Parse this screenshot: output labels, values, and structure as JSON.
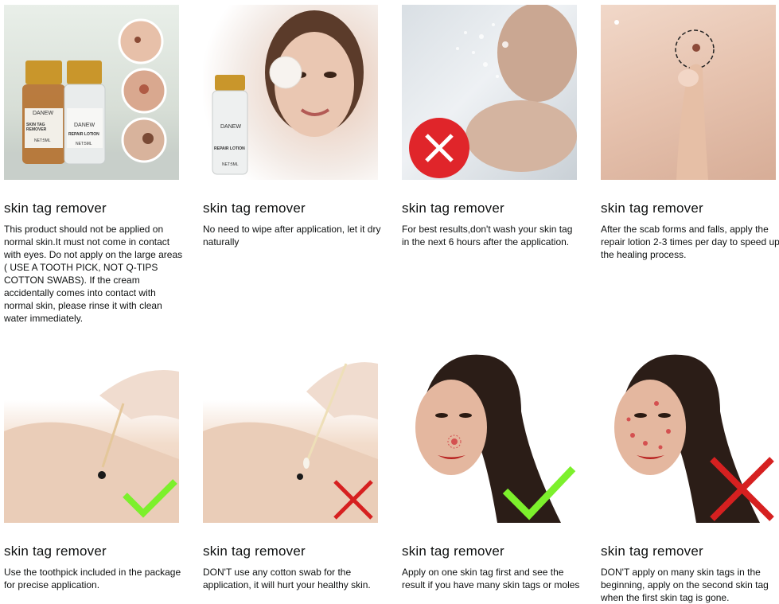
{
  "cards": [
    {
      "title": "skin tag remover",
      "desc": "This product should not be applied on normal skin.It must not come in contact with eyes. Do not apply on the large areas ( USE A TOOTH PICK, NOT Q-TIPS COTTON SWABS). If the cream accidentally comes into contact with normal skin, please rinse it with clean water immediately.",
      "bottle1_brand": "DANEW",
      "bottle1_label": "SKIN TAG REMOVER",
      "bottle1_size": "NET:5ML",
      "bottle2_brand": "DANEW",
      "bottle2_label": "REPAIR LOTION",
      "bottle2_size": "NET:5ML"
    },
    {
      "title": "skin tag remover",
      "desc": "No need to wipe after application, let it dry naturally",
      "bottle_brand": "DANEW",
      "bottle_label": "REPAIR LOTION",
      "bottle_size": "NET:5ML"
    },
    {
      "title": "skin tag remover",
      "desc": "For best results,don't wash your skin tag in the next 6 hours after the application."
    },
    {
      "title": "skin tag remover",
      "desc": "After the scab forms and falls, apply the repair lotion 2-3 times per day to speed up the healing process."
    },
    {
      "title": "skin tag remover",
      "desc": "Use the toothpick included in the package for precise application."
    },
    {
      "title": "skin tag remover",
      "desc": "DON'T use any cotton swab for the application, it will hurt your healthy skin."
    },
    {
      "title": "skin tag remover",
      "desc": "Apply on one skin tag first and see the result if you have many skin tags or moles"
    },
    {
      "title": "skin tag remover",
      "desc": "DON'T apply on many skin tags in the beginning, apply on the second skin tag when the first skin tag is gone."
    }
  ],
  "colors": {
    "check_green": "#7cf02c",
    "cross_red": "#d62020",
    "wash_circle": "#e0252a"
  },
  "icons": [
    "check-icon",
    "cross-icon"
  ]
}
